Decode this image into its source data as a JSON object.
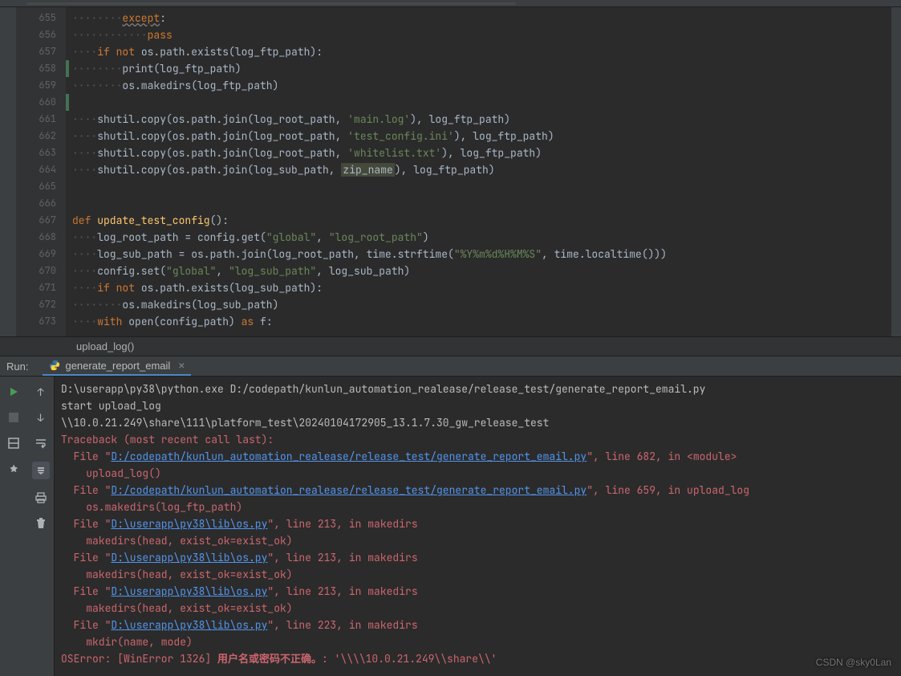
{
  "editor": {
    "line_start": 655,
    "lines": [
      {
        "n": 655,
        "indent": 2,
        "seg": [
          {
            "t": "except",
            "c": "c-kw c-warn"
          },
          {
            "t": ":"
          }
        ]
      },
      {
        "n": 656,
        "indent": 3,
        "seg": [
          {
            "t": "pass",
            "c": "c-kw"
          }
        ]
      },
      {
        "n": 657,
        "indent": 1,
        "fold": "-",
        "seg": [
          {
            "t": "if not ",
            "c": "c-kw"
          },
          {
            "t": "os.path.exists(log_ftp_path):"
          }
        ]
      },
      {
        "n": 658,
        "indent": 2,
        "mark": true,
        "seg": [
          {
            "t": "print",
            "c": ""
          },
          {
            "t": "(log_ftp_path)"
          }
        ]
      },
      {
        "n": 659,
        "indent": 2,
        "fold": "-",
        "seg": [
          {
            "t": "os.makedirs(log_ftp_path)"
          }
        ]
      },
      {
        "n": 660,
        "indent": 0,
        "mark": true,
        "seg": [
          {
            "t": ""
          }
        ]
      },
      {
        "n": 661,
        "indent": 1,
        "seg": [
          {
            "t": "shutil.copy(os.path.join(log_root_path, "
          },
          {
            "t": "'main.log'",
            "c": "c-str"
          },
          {
            "t": "), log_ftp_path)"
          }
        ]
      },
      {
        "n": 662,
        "indent": 1,
        "seg": [
          {
            "t": "shutil.copy(os.path.join(log_root_path, "
          },
          {
            "t": "'test_config.ini'",
            "c": "c-str"
          },
          {
            "t": "), log_ftp_path)"
          }
        ]
      },
      {
        "n": 663,
        "indent": 1,
        "seg": [
          {
            "t": "shutil.copy(os.path.join(log_root_path, "
          },
          {
            "t": "'whitelist.txt'",
            "c": "c-str"
          },
          {
            "t": "), log_ftp_path)"
          }
        ]
      },
      {
        "n": 664,
        "indent": 1,
        "fold": "-",
        "seg": [
          {
            "t": "shutil.copy(os.path.join(log_sub_path, "
          },
          {
            "t": "zip_name",
            "c": "c-param-hi"
          },
          {
            "t": "), log_ftp_path)"
          }
        ]
      },
      {
        "n": 665,
        "indent": 0,
        "seg": [
          {
            "t": ""
          }
        ]
      },
      {
        "n": 666,
        "indent": 0,
        "seg": [
          {
            "t": ""
          }
        ]
      },
      {
        "n": 667,
        "indent": 0,
        "fold": "-",
        "seg": [
          {
            "t": "def ",
            "c": "c-kw"
          },
          {
            "t": "update_test_config",
            "c": "c-func"
          },
          {
            "t": "():"
          }
        ]
      },
      {
        "n": 668,
        "indent": 1,
        "seg": [
          {
            "t": "log_root_path = config.get("
          },
          {
            "t": "\"global\"",
            "c": "c-str"
          },
          {
            "t": ", "
          },
          {
            "t": "\"log_root_path\"",
            "c": "c-str"
          },
          {
            "t": ")"
          }
        ]
      },
      {
        "n": 669,
        "indent": 1,
        "seg": [
          {
            "t": "log_sub_path = os.path.join(log_root_path, time.strftime("
          },
          {
            "t": "\"%Y%m%d%H%M%S\"",
            "c": "c-str"
          },
          {
            "t": ", time.localtime()))"
          }
        ]
      },
      {
        "n": 670,
        "indent": 1,
        "seg": [
          {
            "t": "config.set("
          },
          {
            "t": "\"global\"",
            "c": "c-str"
          },
          {
            "t": ", "
          },
          {
            "t": "\"log_sub_path\"",
            "c": "c-str"
          },
          {
            "t": ", log_sub_path)"
          }
        ]
      },
      {
        "n": 671,
        "indent": 1,
        "fold": "-",
        "seg": [
          {
            "t": "if not ",
            "c": "c-kw"
          },
          {
            "t": "os.path.exists(log_sub_path):"
          }
        ]
      },
      {
        "n": 672,
        "indent": 2,
        "seg": [
          {
            "t": "os.makedirs(log_sub_path)"
          }
        ]
      },
      {
        "n": 673,
        "indent": 1,
        "seg": [
          {
            "t": "with ",
            "c": "c-kw"
          },
          {
            "t": "open",
            "c": ""
          },
          {
            "t": "(config_path) "
          },
          {
            "t": "as ",
            "c": "c-kw"
          },
          {
            "t": "f:"
          }
        ]
      }
    ]
  },
  "breadcrumb": {
    "text": "upload_log()"
  },
  "run": {
    "label": "Run:",
    "tab": "generate_report_email",
    "console": [
      {
        "t": "D:\\userapp\\py38\\python.exe D:/codepath/kunlun_automation_realease/release_test/generate_report_email.py"
      },
      {
        "t": "start upload_log"
      },
      {
        "t": "\\\\10.0.21.249\\share\\111\\platform_test\\20240104172905_13.1.7.30_gw_release_test"
      },
      {
        "t": "Traceback (most recent call last):",
        "c": "con-err"
      },
      {
        "pre": "  File \"",
        "link": "D:/codepath/kunlun_automation_realease/release_test/generate_report_email.py",
        "post": "\", line 682, in <module>",
        "c": "con-err"
      },
      {
        "t": "    upload_log()",
        "c": "con-err"
      },
      {
        "pre": "  File \"",
        "link": "D:/codepath/kunlun_automation_realease/release_test/generate_report_email.py",
        "post": "\", line 659, in upload_log",
        "c": "con-err"
      },
      {
        "t": "    os.makedirs(log_ftp_path)",
        "c": "con-err"
      },
      {
        "pre": "  File \"",
        "link": "D:\\userapp\\py38\\lib\\os.py",
        "post": "\", line 213, in makedirs",
        "c": "con-err"
      },
      {
        "t": "    makedirs(head, exist_ok=exist_ok)",
        "c": "con-err"
      },
      {
        "pre": "  File \"",
        "link": "D:\\userapp\\py38\\lib\\os.py",
        "post": "\", line 213, in makedirs",
        "c": "con-err"
      },
      {
        "t": "    makedirs(head, exist_ok=exist_ok)",
        "c": "con-err"
      },
      {
        "pre": "  File \"",
        "link": "D:\\userapp\\py38\\lib\\os.py",
        "post": "\", line 213, in makedirs",
        "c": "con-err"
      },
      {
        "t": "    makedirs(head, exist_ok=exist_ok)",
        "c": "con-err"
      },
      {
        "pre": "  File \"",
        "link": "D:\\userapp\\py38\\lib\\os.py",
        "post": "\", line 223, in makedirs",
        "c": "con-err"
      },
      {
        "t": "    mkdir(name, mode)",
        "c": "con-err"
      },
      {
        "rich": [
          {
            "t": "OSError: [WinError 1326] ",
            "c": "con-err"
          },
          {
            "t": "用户名或密码不正确。",
            "c": "con-err con-bold"
          },
          {
            "t": ": '\\\\\\\\10.0.21.249\\\\share\\\\'",
            "c": "con-err"
          }
        ]
      }
    ]
  },
  "watermark": "CSDN @sky0Lan"
}
